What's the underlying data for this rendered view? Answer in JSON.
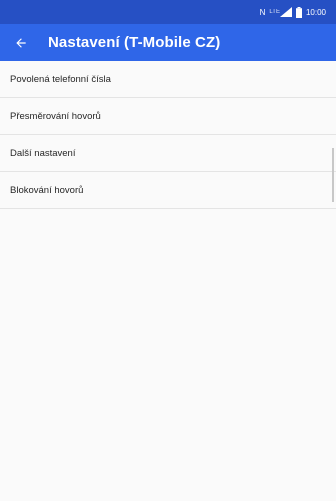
{
  "status": {
    "network_label": "N",
    "signal_label": "LTE",
    "time": "10:00"
  },
  "toolbar": {
    "back_icon": "arrow-back-icon",
    "title": "Nastavení (T-Mobile CZ)"
  },
  "items": [
    {
      "label": "Povolená telefonní čísla"
    },
    {
      "label": "Přesměrování hovorů"
    },
    {
      "label": "Další nastavení"
    },
    {
      "label": "Blokování hovorů"
    }
  ],
  "colors": {
    "statusbar": "#2650c4",
    "toolbar": "#2f66e8",
    "background": "#fafafa"
  }
}
